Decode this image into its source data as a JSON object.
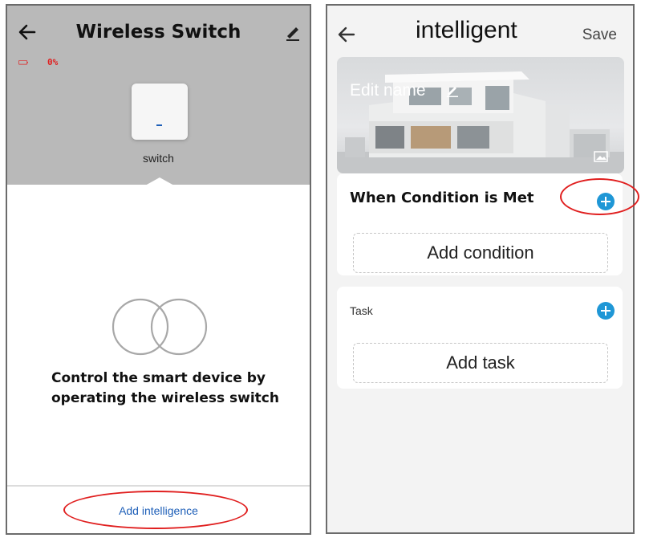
{
  "left_screen": {
    "title": "Wireless Switch",
    "battery_text": "0%",
    "switch_label": "switch",
    "description_lines": [
      "Control the smart device by",
      "operating the wireless switch"
    ],
    "add_intelligence_label": "Add intelligence",
    "icons": [
      "back-arrow-icon",
      "edit-pencil-icon",
      "battery-icon",
      "linked-circles-icon"
    ]
  },
  "right_screen": {
    "title": "intelligent",
    "save_label": "Save",
    "edit_name_label": "Edit name",
    "condition_heading": "When Condition is Met",
    "add_condition_label": "Add condition",
    "task_heading": "Task",
    "add_task_label": "Add task",
    "icons": [
      "back-arrow-icon",
      "pencil-icon",
      "image-icon",
      "plus-circle-icon"
    ]
  },
  "colors": {
    "header_gray": "#b9b9b9",
    "link_blue": "#1e5fb8",
    "plus_blue": "#1f97d6",
    "highlight_red": "#e01e1e",
    "battery_red": "#e02020"
  }
}
